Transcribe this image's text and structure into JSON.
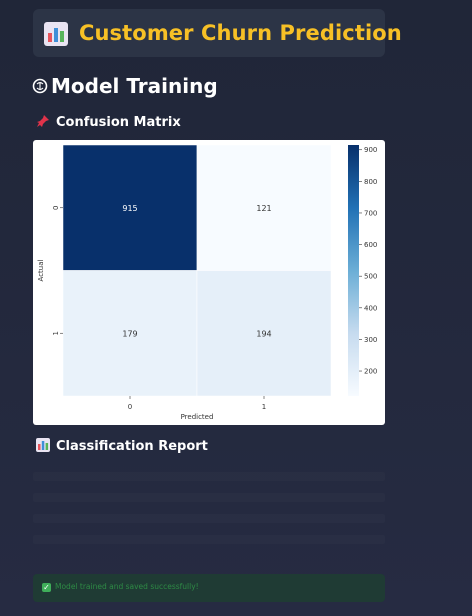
{
  "header": {
    "title": "Customer Churn Prediction",
    "icon": "bar-chart-icon"
  },
  "section": {
    "title": "Model Training",
    "icon": "brain-icon"
  },
  "confusion_matrix_section": {
    "title": "Confusion Matrix",
    "icon": "pushpin-icon"
  },
  "classification_report_section": {
    "title": "Classification Report",
    "icon": "bar-chart-icon"
  },
  "success_message": {
    "text": "Model trained and saved successfully!",
    "icon": "check-icon"
  },
  "chart_data": {
    "type": "heatmap",
    "xlabel": "Predicted",
    "ylabel": "Actual",
    "x_categories": [
      "0",
      "1"
    ],
    "y_categories": [
      "0",
      "1"
    ],
    "values": [
      [
        915,
        121
      ],
      [
        179,
        194
      ]
    ],
    "colorbar": {
      "min": 121,
      "max": 915,
      "ticks": [
        200,
        300,
        400,
        500,
        600,
        700,
        800,
        900
      ],
      "colormap": "Blues"
    }
  },
  "colors": {
    "title": "#f7c026",
    "background": "#232a3f",
    "success_text": "#2e8a45"
  }
}
